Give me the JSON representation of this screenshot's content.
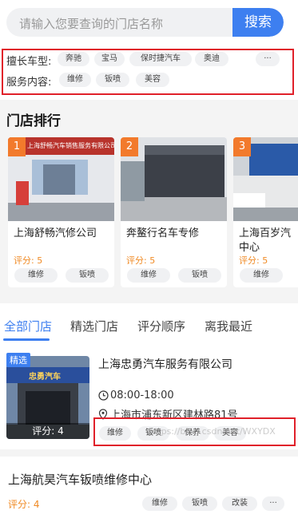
{
  "search": {
    "placeholder": "请输入您要查询的门店名称",
    "button": "搜索"
  },
  "filters": {
    "brand_label": "擅长车型:",
    "brands": [
      "奔驰",
      "宝马",
      "保时捷汽车",
      "奥迪",
      "···"
    ],
    "service_label": "服务内容:",
    "services": [
      "维修",
      "钣喷",
      "美容"
    ]
  },
  "ranking": {
    "title": "门店排行",
    "cards": [
      {
        "rank": "1",
        "name": "上海舒畅汽修公司",
        "score": "评分: 5",
        "tags": [
          "维修",
          "钣喷"
        ],
        "sign": "上海舒畅汽车销售服务有限公司"
      },
      {
        "rank": "2",
        "name": "奔鳌行名车专修",
        "score": "评分: 5",
        "tags": [
          "维修",
          "钣喷"
        ]
      },
      {
        "rank": "3",
        "name": "上海百岁汽车维修中心",
        "name_line1": "上海百岁汽",
        "name_line2": "中心",
        "score": "评分: 5",
        "tags": [
          "维修"
        ]
      }
    ]
  },
  "tabs": [
    "全部门店",
    "精选门店",
    "评分顺序",
    "离我最近"
  ],
  "store1": {
    "badge": "精选",
    "name": "上海忠勇汽车服务有限公司",
    "hours": "08:00-18:00",
    "address": "上海市浦东新区建林路81号",
    "score": "评分: 4",
    "sign": "忠勇汽车",
    "tags": [
      "维修",
      "钣喷",
      "保养",
      "美容"
    ],
    "watermark": "https://blog.csdn.net/WXYDX"
  },
  "store2": {
    "name": "上海航昊汽车钣喷维修中心",
    "score": "评分: 4",
    "tags": [
      "维修",
      "钣喷",
      "改装",
      "···"
    ]
  },
  "colors": {
    "accent": "#3d7ff0",
    "rank": "#f27a2c",
    "score": "#f08a24",
    "highlight": "#e0202a"
  }
}
